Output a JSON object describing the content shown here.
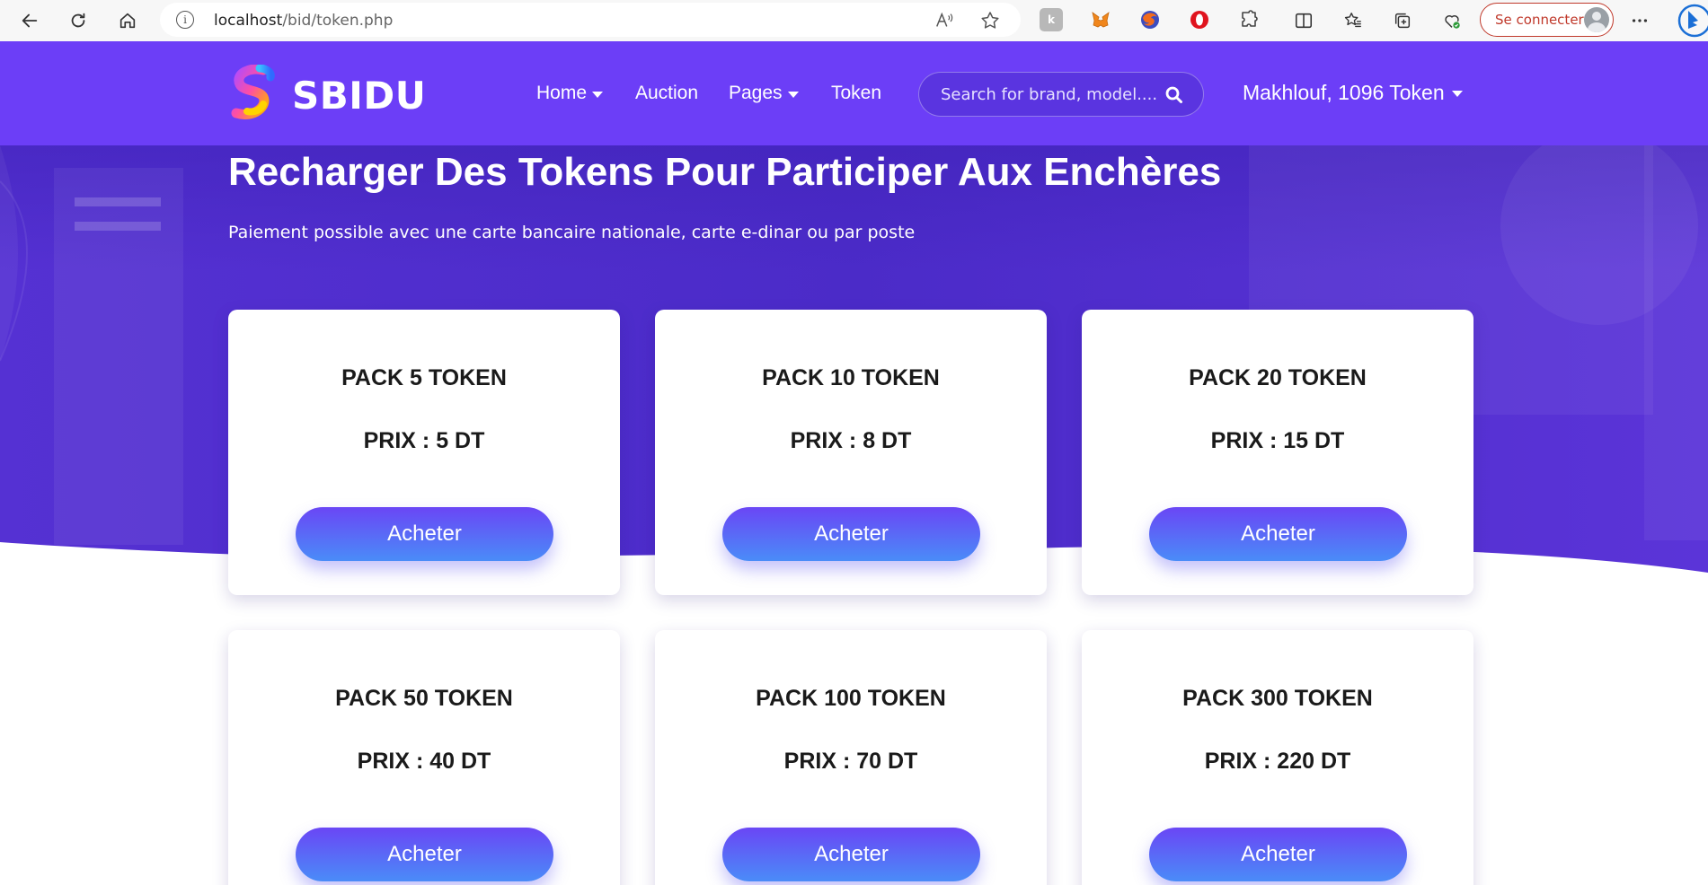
{
  "browser": {
    "url_host": "localhost",
    "url_path": "/bid/token.php",
    "signin_label": "Se connecter",
    "extensions": [
      "k-extension-icon",
      "metamask-icon",
      "firefox-icon",
      "opera-icon",
      "puzzle-icon"
    ]
  },
  "header": {
    "logo_text": "SBIDU",
    "nav": [
      {
        "label": "Home",
        "has_dropdown": true
      },
      {
        "label": "Auction",
        "has_dropdown": false
      },
      {
        "label": "Pages",
        "has_dropdown": true
      },
      {
        "label": "Token",
        "has_dropdown": false
      }
    ],
    "search_placeholder": "Search for brand, model....",
    "user_label": "Makhlouf, 1096 Token"
  },
  "hero": {
    "title": "Recharger Des Tokens Pour Participer Aux Enchères",
    "subtitle": "Paiement possible avec une carte bancaire nationale, carte e-dinar ou par poste"
  },
  "packs": [
    {
      "title": "PACK 5 TOKEN",
      "price": "PRIX : 5 DT",
      "button": "Acheter"
    },
    {
      "title": "PACK 10 TOKEN",
      "price": "PRIX : 8 DT",
      "button": "Acheter"
    },
    {
      "title": "PACK 20 TOKEN",
      "price": "PRIX : 15 DT",
      "button": "Acheter"
    },
    {
      "title": "PACK 50 TOKEN",
      "price": "PRIX : 40 DT",
      "button": "Acheter"
    },
    {
      "title": "PACK 100 TOKEN",
      "price": "PRIX : 70 DT",
      "button": "Acheter"
    },
    {
      "title": "PACK 300 TOKEN",
      "price": "PRIX : 220 DT",
      "button": "Acheter"
    }
  ],
  "colors": {
    "header_bg": "#6c3ef7",
    "hero_bg": "#4f2fd0",
    "button_top": "#6a46f5",
    "button_bottom": "#4a8cf8",
    "signin_accent": "#c0392b"
  }
}
